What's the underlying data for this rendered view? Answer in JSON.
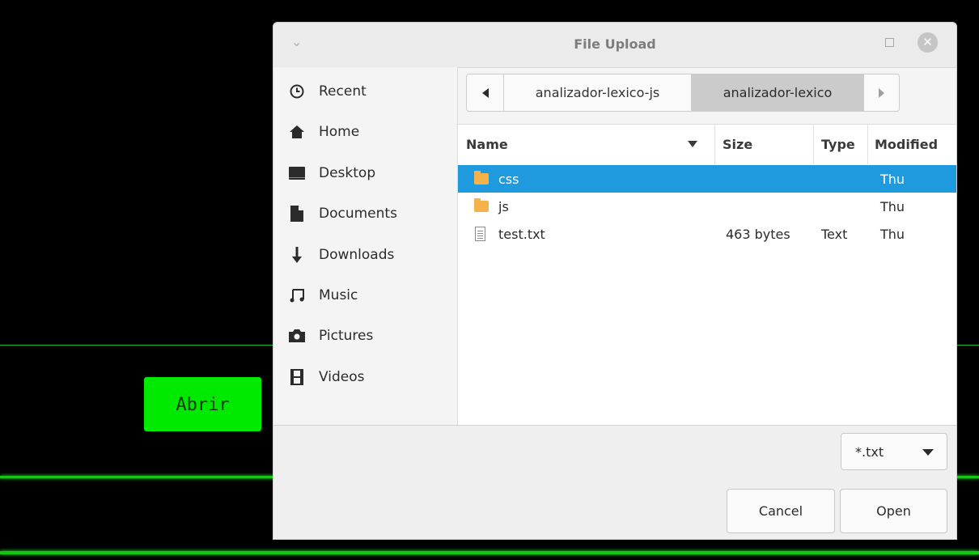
{
  "background": {
    "open_button_label": "Abrir",
    "accent_color": "#00ea00"
  },
  "dialog": {
    "title": "File Upload",
    "sidebar": {
      "items": [
        {
          "label": "Recent",
          "icon": "clock-icon"
        },
        {
          "label": "Home",
          "icon": "home-icon"
        },
        {
          "label": "Desktop",
          "icon": "desktop-icon"
        },
        {
          "label": "Documents",
          "icon": "document-icon"
        },
        {
          "label": "Downloads",
          "icon": "download-arrow-icon"
        },
        {
          "label": "Music",
          "icon": "music-note-icon"
        },
        {
          "label": "Pictures",
          "icon": "camera-icon"
        },
        {
          "label": "Videos",
          "icon": "film-icon"
        }
      ]
    },
    "pathbar": {
      "segments": [
        "analizador-lexico-js",
        "analizador-lexico"
      ],
      "active_segment": "analizador-lexico"
    },
    "file_list": {
      "columns": {
        "name": "Name",
        "size": "Size",
        "type": "Type",
        "modified": "Modified"
      },
      "rows": [
        {
          "name": "css",
          "size": "",
          "type": "",
          "modified": "Thu",
          "kind": "folder",
          "selected": true
        },
        {
          "name": "js",
          "size": "",
          "type": "",
          "modified": "Thu",
          "kind": "folder",
          "selected": false
        },
        {
          "name": "test.txt",
          "size": "463 bytes",
          "type": "Text",
          "modified": "Thu",
          "kind": "text-file",
          "selected": false
        }
      ]
    },
    "filter": {
      "value": "*.txt"
    },
    "buttons": {
      "cancel": "Cancel",
      "open": "Open"
    },
    "selection_color": "#1f9ade"
  }
}
